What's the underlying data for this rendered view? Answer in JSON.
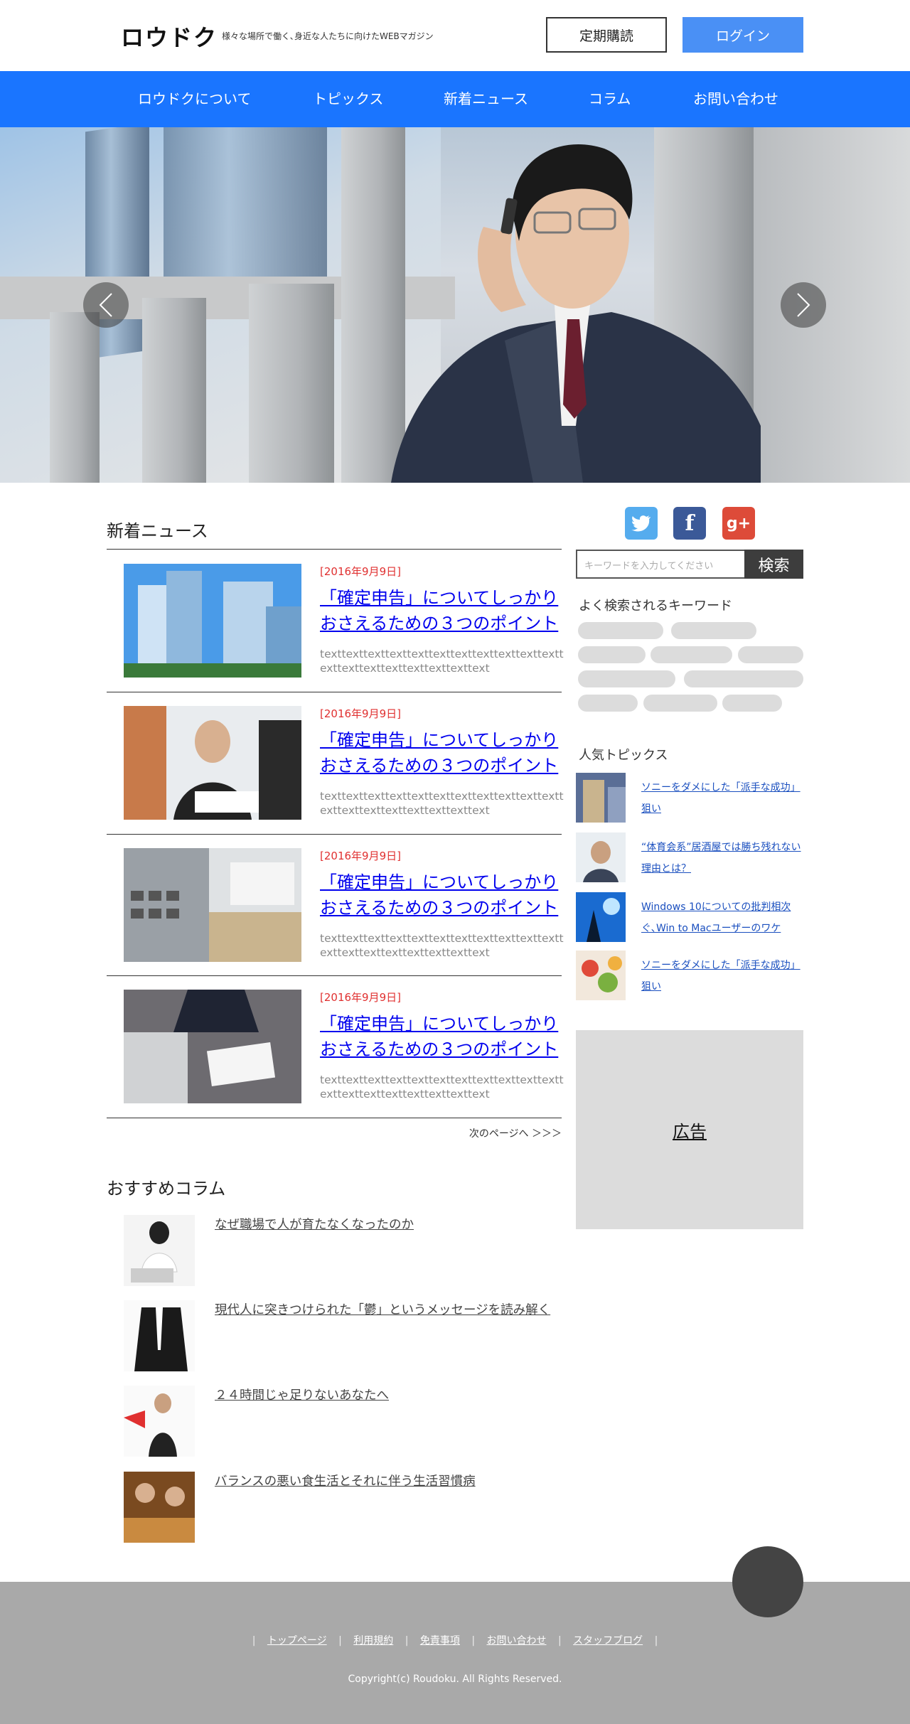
{
  "header": {
    "logo": "ロウドク",
    "tagline": "様々な場所で働く､身近な人たちに向けたWEBマガジン",
    "subscribe_label": "定期購読",
    "login_label": "ログイン"
  },
  "nav": {
    "items": [
      {
        "label": "ロウドクについて"
      },
      {
        "label": "トピックス"
      },
      {
        "label": "新着ニュース"
      },
      {
        "label": "コラム"
      },
      {
        "label": "お問い合わせ"
      }
    ]
  },
  "hero": {
    "prev_icon": "chevron-left-icon",
    "next_icon": "chevron-right-icon"
  },
  "news": {
    "heading": "新着ニュース",
    "items": [
      {
        "date": "[2016年9月9日]",
        "title": "「確定申告」についてしっかりおさえるための３つのポイント",
        "text": "texttexttexttexttexttexttexttexttexttexttexttexttexttexttexttexttexttexttext"
      },
      {
        "date": "[2016年9月9日]",
        "title": "「確定申告」についてしっかりおさえるための３つのポイント",
        "text": "texttexttexttexttexttexttexttexttexttexttexttexttexttexttexttexttexttexttext"
      },
      {
        "date": "[2016年9月9日]",
        "title": "「確定申告」についてしっかりおさえるための３つのポイント",
        "text": "texttexttexttexttexttexttexttexttexttexttexttexttexttexttexttexttexttexttext"
      },
      {
        "date": "[2016年9月9日]",
        "title": "「確定申告」についてしっかりおさえるための３つのポイント",
        "text": "texttexttexttexttexttexttexttexttexttexttexttexttexttexttexttexttexttexttext"
      }
    ],
    "next_page": "次のページへ ＞＞＞"
  },
  "columns": {
    "heading": "おすすめコラム",
    "items": [
      {
        "title": "なぜ職場で人が育たなくなったのか"
      },
      {
        "title": "現代人に突きつけられた「鬱」というメッセージを読み解く"
      },
      {
        "title": "２４時間じゃ足りないあなたへ"
      },
      {
        "title": "バランスの悪い食生活とそれに伴う生活習慣病"
      }
    ]
  },
  "sidebar": {
    "social": [
      {
        "icon": "twitter-icon",
        "color": "#55acee"
      },
      {
        "icon": "facebook-icon",
        "color": "#3b5998"
      },
      {
        "icon": "google-plus-icon",
        "color": "#dd4b39"
      }
    ],
    "social_glyphs": {
      "facebook": "f",
      "google_plus": "g+"
    },
    "search_placeholder": "キーワードを入力してください",
    "search_button": "検索",
    "keywords_heading": "よく検索されるキーワード",
    "popular_heading": "人気トピックス",
    "popular": [
      {
        "title": "ソニーをダメにした「派手な成功」狙い"
      },
      {
        "title": "“体育会系”居酒屋では勝ち残れない理由とは？"
      },
      {
        "title": "Windows 10についての批判相次ぐ､Win to Macユーザーのワケ"
      },
      {
        "title": "ソニーをダメにした「派手な成功」狙い"
      }
    ],
    "ad_label": "広告"
  },
  "footer": {
    "links": [
      {
        "label": "トップページ"
      },
      {
        "label": "利用規約"
      },
      {
        "label": "免責事項"
      },
      {
        "label": "お問い合わせ"
      },
      {
        "label": "スタッフブログ"
      }
    ],
    "separator": "|",
    "copyright": "Copyright(c) Roudoku. All Rights Reserved."
  },
  "colors": {
    "nav_blue": "#1a75ff",
    "login_blue": "#4a90f5",
    "date_red": "#e03030",
    "link_blue": "#0000ee",
    "footer_gray": "#a9a9a9"
  }
}
